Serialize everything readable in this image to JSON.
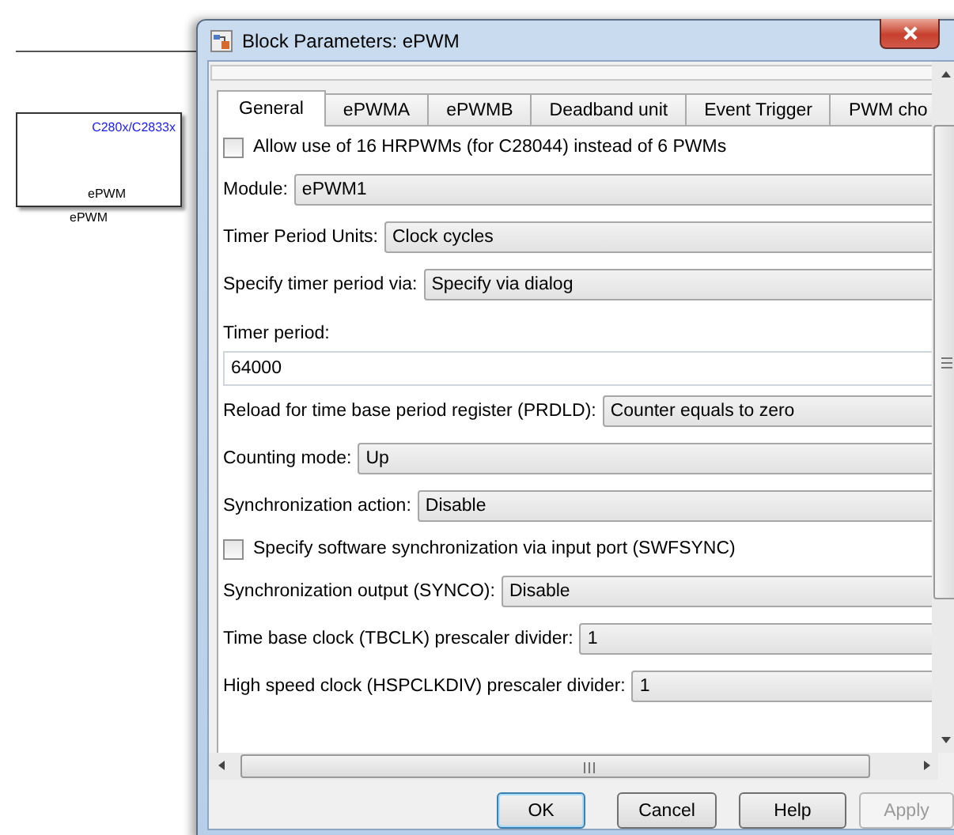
{
  "canvas": {
    "block": {
      "library": "C280x/C2833x",
      "label": "ePWM",
      "name": "ePWM"
    }
  },
  "dialog": {
    "title": "Block Parameters: ePWM",
    "tabs": [
      {
        "label": "General",
        "selected": true
      },
      {
        "label": "ePWMA",
        "selected": false
      },
      {
        "label": "ePWMB",
        "selected": false
      },
      {
        "label": "Deadband unit",
        "selected": false
      },
      {
        "label": "Event Trigger",
        "selected": false
      },
      {
        "label": "PWM cho",
        "selected": false
      }
    ],
    "params": [
      {
        "kind": "checkbox",
        "label": "Allow use of 16 HRPWMs (for C28044) instead of 6 PWMs",
        "checked": false
      },
      {
        "kind": "dropdown",
        "label": "Module:",
        "value": "ePWM1"
      },
      {
        "kind": "dropdown",
        "label": "Timer Period Units:",
        "value": "Clock cycles"
      },
      {
        "kind": "dropdown",
        "label": "Specify timer period via:",
        "value": "Specify via dialog"
      },
      {
        "kind": "label",
        "label": "Timer period:"
      },
      {
        "kind": "edit",
        "value": "64000"
      },
      {
        "kind": "dropdown",
        "label": "Reload for time base period register (PRDLD):",
        "value": "Counter equals to zero"
      },
      {
        "kind": "dropdown",
        "label": "Counting mode:",
        "value": "Up"
      },
      {
        "kind": "dropdown",
        "label": "Synchronization action:",
        "value": "Disable"
      },
      {
        "kind": "checkbox",
        "label": "Specify software synchronization via input port (SWFSYNC)",
        "checked": false
      },
      {
        "kind": "dropdown",
        "label": "Synchronization output (SYNCO):",
        "value": "Disable"
      },
      {
        "kind": "dropdown",
        "label": "Time base clock (TBCLK) prescaler divider:",
        "value": "1"
      },
      {
        "kind": "dropdown",
        "label": "High speed clock (HSPCLKDIV) prescaler divider:",
        "value": "1"
      }
    ],
    "buttons": [
      {
        "label": "OK",
        "focused": true,
        "disabled": false
      },
      {
        "label": "Cancel",
        "focused": false,
        "disabled": false
      },
      {
        "label": "Help",
        "focused": false,
        "disabled": false
      },
      {
        "label": "Apply",
        "focused": false,
        "disabled": true
      }
    ]
  }
}
